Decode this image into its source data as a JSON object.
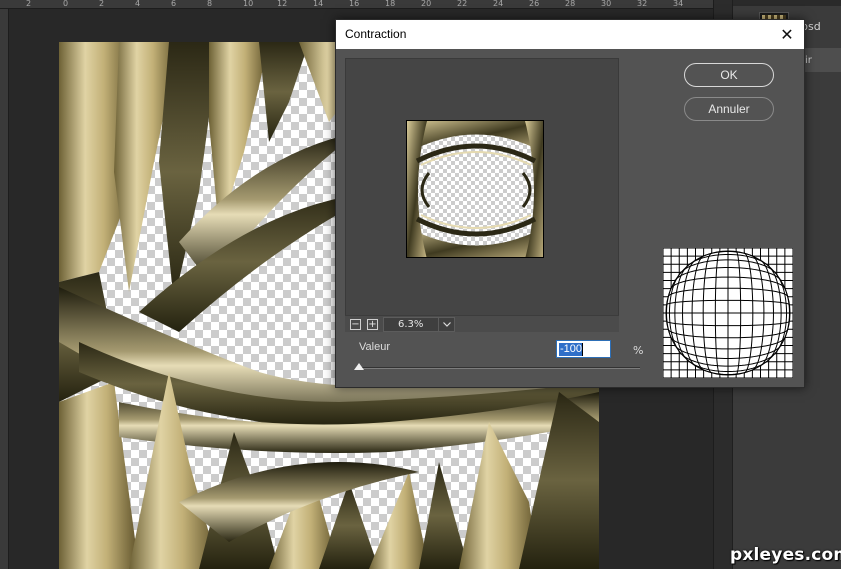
{
  "ruler": {
    "ticks": [
      "2",
      "0",
      "2",
      "4",
      "6",
      "8",
      "10",
      "12",
      "14",
      "16",
      "18",
      "20",
      "22",
      "24",
      "26",
      "28",
      "30",
      "32",
      "34"
    ]
  },
  "right_panel": {
    "file_label": "psd",
    "row_label": "vrir"
  },
  "watermark": "pxleyes.com",
  "dialog": {
    "title": "Contraction",
    "close_glyph": "✕",
    "ok_label": "OK",
    "cancel_label": "Annuler",
    "zoom": {
      "out_glyph": "−",
      "in_glyph": "+",
      "value": "6.3%"
    },
    "value_label": "Valeur",
    "value": "-100",
    "unit": "%",
    "slider": {
      "value": -100,
      "min": -100,
      "max": 100
    }
  },
  "colors": {
    "dialog_bg": "#535353",
    "titlebar_bg": "#ffffff",
    "selection": "#2f6fc9",
    "artwork_light": "#c9b986",
    "artwork_dark": "#3e3a22"
  },
  "icons": {
    "close": "close-icon",
    "zoom_out": "zoom-out-icon",
    "zoom_in": "zoom-in-icon",
    "dropdown": "chevron-down-icon"
  }
}
